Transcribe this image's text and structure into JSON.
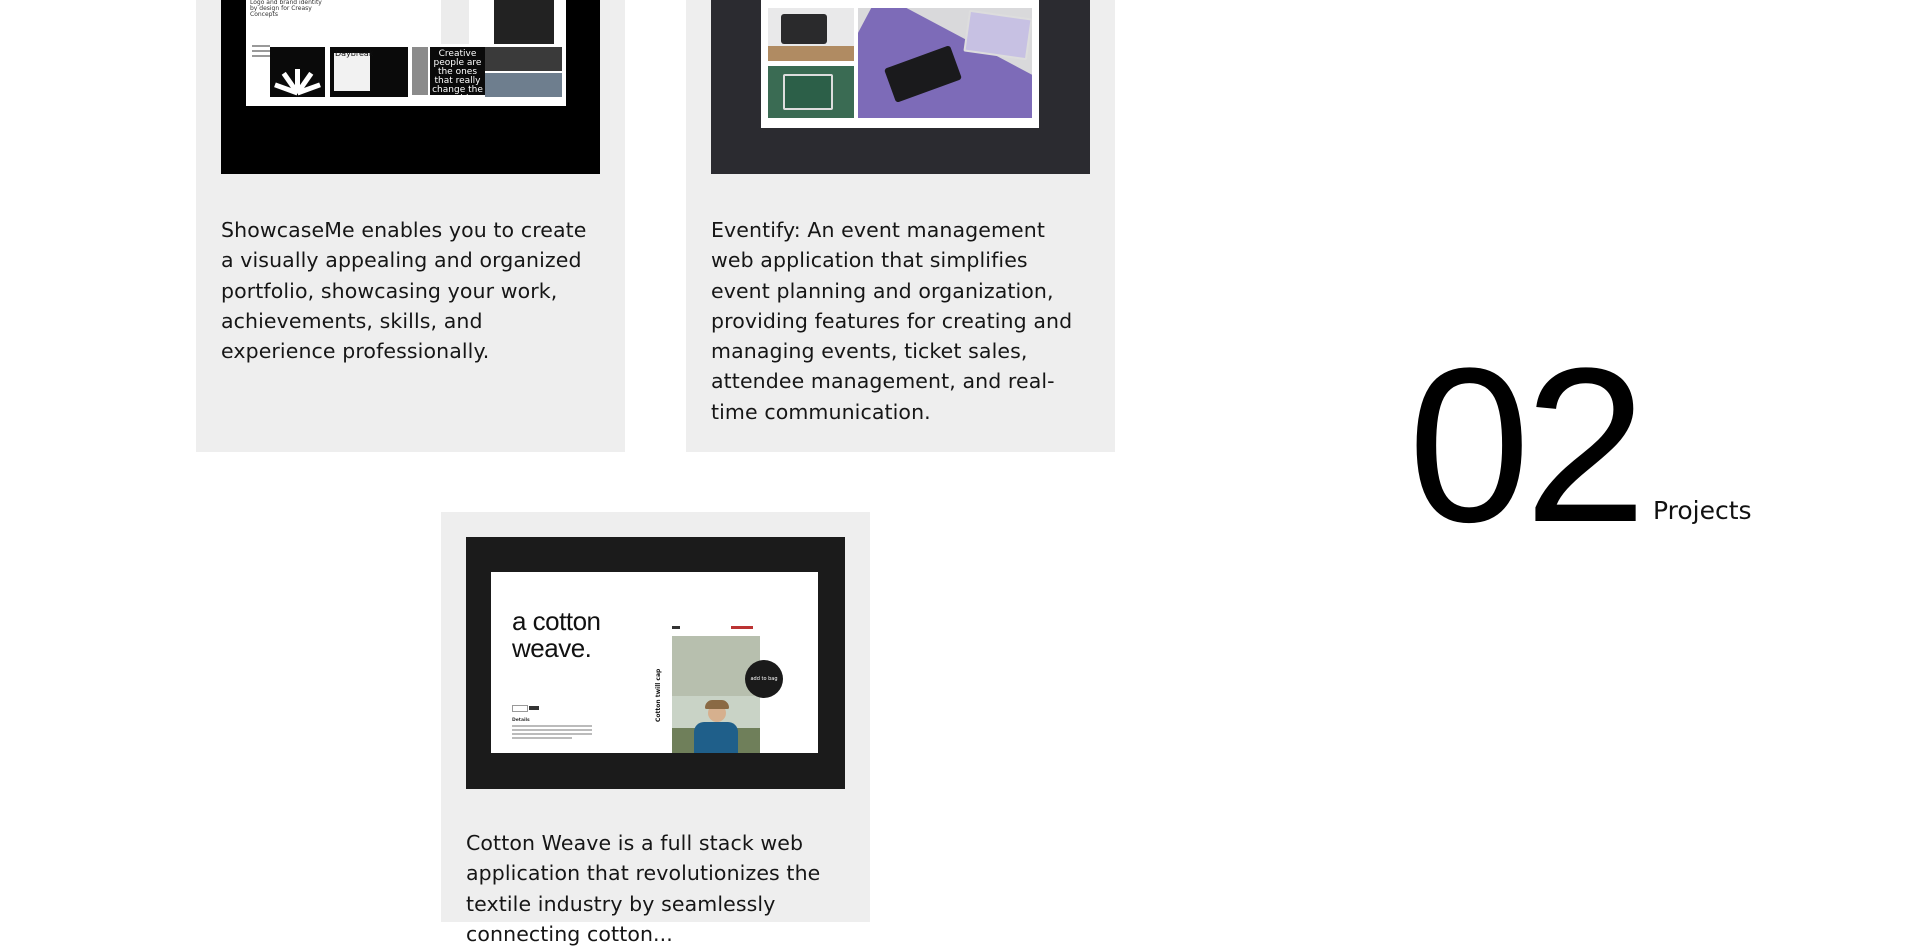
{
  "projects": [
    {
      "name": "ShowcaseMe",
      "thumbnail": {
        "sheet_title": "Logo and brand identity by design for Creasy Concepts",
        "panel_label": "Daybreak",
        "quote": "Creative people are the ones that really change the world."
      },
      "description": "ShowcaseMe enables you to create a visually appealing and organized portfolio, showcasing your work, achievements, skills, and experience professionally."
    },
    {
      "name": "Eventify",
      "description": "Eventify: An event management web application that simplifies event planning and organization, providing features for creating and managing events, ticket sales, attendee management, and real-time communication."
    },
    {
      "name": "Cotton Weave",
      "thumbnail": {
        "headline_line1": "a cotton",
        "headline_line2": "weave.",
        "bubble": "add to bag",
        "vertical_label": "Cotton twill cap",
        "details_label": "Details"
      },
      "description": "Cotton Weave is a full stack web application that revolutionizes the textile industry by seamlessly connecting cotton..."
    }
  ],
  "counter": {
    "number": "02",
    "label": "Projects"
  },
  "colors": {
    "card_bg": "#eeeeee",
    "thumb_dark": "#000000",
    "thumb_charcoal": "#2b2b30",
    "accent_purple": "#7d6bb8"
  }
}
